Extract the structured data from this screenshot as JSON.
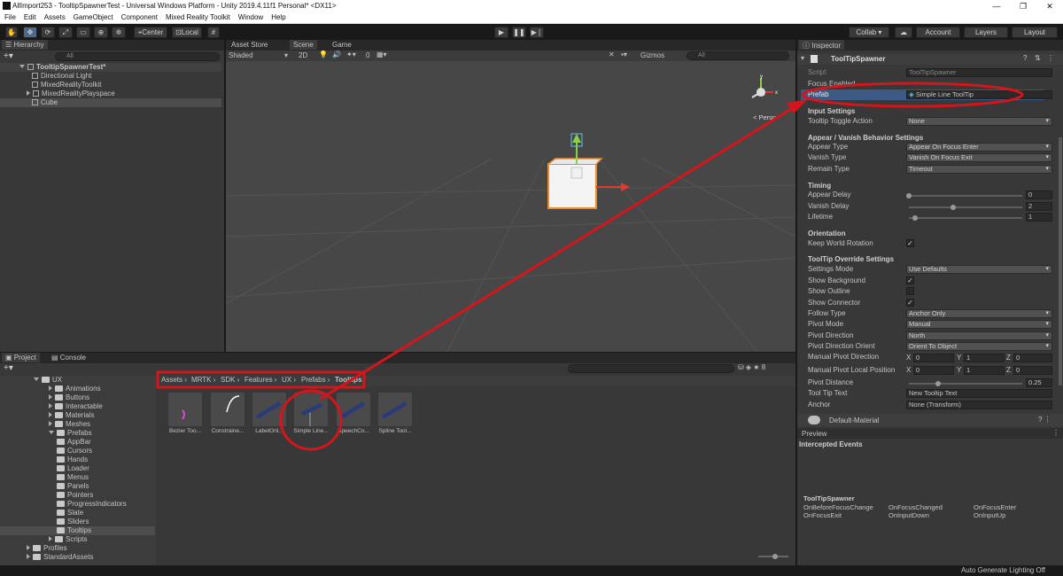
{
  "window": {
    "title": "AllImport253 - TooltipSpawnerTest - Universal Windows Platform - Unity 2019.4.11f1 Personal* <DX11>",
    "minimize": "—",
    "maximize": "❐",
    "close": "✕"
  },
  "menu": [
    "File",
    "Edit",
    "Assets",
    "GameObject",
    "Component",
    "Mixed Reality Toolkit",
    "Window",
    "Help"
  ],
  "toolbar": {
    "center_label": "Center",
    "local_label": "Local",
    "collab_label": "Collab ▾",
    "account_label": "Account",
    "layers_label": "Layers",
    "layout_label": "Layout"
  },
  "hierarchy": {
    "tab": "Hierarchy",
    "search_placeholder": "All",
    "scene": "TooltipSpawnerTest*",
    "items": [
      "Directional Light",
      "MixedRealityToolkit",
      "MixedRealityPlayspace",
      "Cube"
    ]
  },
  "scene_view": {
    "tabs": [
      "Asset Store",
      "Scene",
      "Game"
    ],
    "shading": "Shaded",
    "mode2d": "2D",
    "gizmos": "Gizmos",
    "search_placeholder": "All",
    "persp": "< Persp",
    "stats": "0"
  },
  "project": {
    "tabs": [
      "Project",
      "Console"
    ],
    "folders": [
      "UX",
      "Animations",
      "Buttons",
      "Interactable",
      "Materials",
      "Meshes",
      "Prefabs",
      "AppBar",
      "Cursors",
      "Hands",
      "Loader",
      "Menus",
      "Panels",
      "Pointers",
      "ProgressIndicators",
      "Slate",
      "Sliders",
      "Tooltips",
      "Scripts",
      "Profiles",
      "StandardAssets"
    ],
    "breadcrumb": [
      "Assets",
      "MRTK",
      "SDK",
      "Features",
      "UX",
      "Prefabs",
      "Tooltips"
    ],
    "assets": [
      "Bezier Too...",
      "Constraine...",
      "LabelOnl...",
      "Simple Line...",
      "SpeechCo...",
      "Spline Tool..."
    ],
    "count": "8"
  },
  "inspector": {
    "tab": "Inspector",
    "component": "ToolTipSpawner",
    "script_label": "Script",
    "script_value": "ToolTipSpawner",
    "focus_label": "Focus Enabled",
    "prefab_label": "Prefab",
    "prefab_value": "Simple Line ToolTip",
    "input_settings": "Input Settings",
    "toggle_label": "Tooltip Toggle Action",
    "toggle_value": "None",
    "appear_section": "Appear / Vanish Behavior Settings",
    "appear_type_label": "Appear Type",
    "appear_type": "Appear On Focus Enter",
    "vanish_type_label": "Vanish Type",
    "vanish_type": "Vanish On Focus Exit",
    "remain_type_label": "Remain Type",
    "remain_type": "Timeout",
    "timing": "Timing",
    "appear_delay_label": "Appear Delay",
    "appear_delay": "0",
    "vanish_delay_label": "Vanish Delay",
    "vanish_delay": "2",
    "lifetime_label": "Lifetime",
    "lifetime": "1",
    "orientation": "Orientation",
    "keep_world_label": "Keep World Rotation",
    "override": "ToolTip Override Settings",
    "settings_mode_label": "Settings Mode",
    "settings_mode": "Use Defaults",
    "show_bg_label": "Show Background",
    "show_outline_label": "Show Outline",
    "show_connector_label": "Show Connector",
    "follow_label": "Follow Type",
    "follow": "Anchor Only",
    "pivot_mode_label": "Pivot Mode",
    "pivot_mode": "Manual",
    "pivot_dir_label": "Pivot Direction",
    "pivot_dir": "North",
    "pivot_orient_label": "Pivot Direction Orient",
    "pivot_orient": "Orient To Object",
    "manual_dir_label": "Manual Pivot Direction",
    "manual_local_label": "Manual Pivot Local Position",
    "x_label": "X",
    "y_label": "Y",
    "z_label": "Z",
    "mpd": [
      "0",
      "1",
      "0"
    ],
    "mpl": [
      "0",
      "1",
      "0"
    ],
    "pivot_dist_label": "Pivot Distance",
    "pivot_dist": "0.25",
    "tooltip_text_label": "Tool Tip Text",
    "tooltip_text": "New Tooltip Text",
    "anchor_label": "Anchor",
    "anchor": "None (Transform)",
    "material": "Default-Material",
    "preview": "Preview",
    "intercepted": "Intercepted Events",
    "events_title": "ToolTipSpawner",
    "events": [
      "OnBeforeFocusChange",
      "OnFocusChanged",
      "OnFocusEnter",
      "OnFocusExit",
      "OnInputDown",
      "OnInputUp"
    ]
  },
  "status": "Auto Generate Lighting Off",
  "colors": {
    "annotation": "#d4161c",
    "selection_orange": "#f08a24"
  }
}
